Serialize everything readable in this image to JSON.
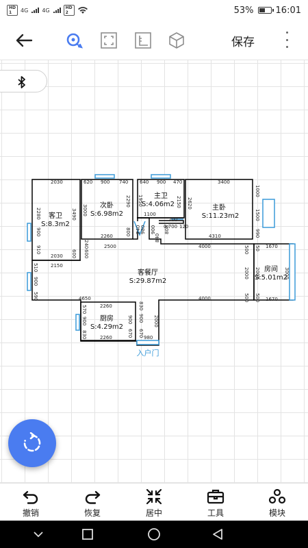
{
  "status": {
    "sim1": {
      "top": "HD",
      "bottom": "1"
    },
    "sim2": {
      "top": "HD",
      "bottom": "2"
    },
    "signal1": "4G",
    "signal2": "4G",
    "battery_percent": "53%",
    "battery_level": 0.53,
    "time": "16:01"
  },
  "toolbar": {
    "save_label": "保存",
    "icons": [
      "arrow-left-icon",
      "pan-move-icon",
      "frame-icon",
      "ruler-icon",
      "3d-box-icon"
    ]
  },
  "bluetooth_icon": "bluetooth-icon",
  "colors": {
    "accent": "#4a7cf0",
    "opening": "#3a9ad9",
    "wall": "#000000",
    "grid": "#e3e3e3"
  },
  "rooms": [
    {
      "name": "客卫",
      "area": "S:8.3m2"
    },
    {
      "name": "次卧",
      "area": "S:6.98m2"
    },
    {
      "name": "主卫",
      "area": "S:4.06m2"
    },
    {
      "name": "主卧",
      "area": "S:11.23m2"
    },
    {
      "name": "客餐厅",
      "area": "S:29.87m2"
    },
    {
      "name": "房间",
      "area": "S:5.01m2"
    },
    {
      "name": "厨房",
      "area": "S:4.29m2"
    }
  ],
  "entrance_label": "入户门",
  "dims": {
    "kewei_top": "2030",
    "kewei_bottom": "2030",
    "kewei_left": "2280",
    "kewei_door": "900",
    "kewei_small": "910",
    "kewei_right": "3490",
    "kewei_rsmall": "600",
    "ciwo_a": "620",
    "ciwo_b": "900",
    "ciwo_c": "740",
    "ciwo_left": "3000",
    "ciwo_right": "2290",
    "ciwo_door": "800",
    "ciwo_bottom": "2260",
    "zhuwei_a": "640",
    "zhuwei_b": "900",
    "zhuwei_c": "470",
    "zhuwei_l1": "1950",
    "zhuwei_r": "2150",
    "zhuwei_1100": "1100",
    "zhuwei_700": "700",
    "zhuwo_top": "3400",
    "zhuwo_l": "2620",
    "zhuwo_r1": "1000",
    "zhuwo_win": "1500",
    "zhuwo_r2": "990",
    "zhuwo_bottom": "4310",
    "c240": "240",
    "c600": "600",
    "c900": "900",
    "c980": "980",
    "c808": "808",
    "c840": "840",
    "c700": "0.700",
    "c120": "120",
    "hall_2150": "2150",
    "hall_2500": "2500",
    "hall_4000a": "4000",
    "hall_4000b": "4000",
    "hall_4650": "4650",
    "hall_510": "510",
    "hall_900": "900",
    "hall_590": "590",
    "hall_2000": "2000",
    "hall_500a": "500",
    "hall_500b": "500",
    "hall_1670a": "1670",
    "hall_1670b": "1670",
    "room_3000": "3000",
    "room_50": "50",
    "room_500": "500",
    "room_2000": "2000",
    "kitchen_top": "2260",
    "kitchen_bottom": "2260",
    "kitchen_570": "570",
    "kitchen_830": "830",
    "kitchen_900": "900",
    "kitchen_670": "670",
    "k_830r": "830",
    "k_900r": "900",
    "k_670r": "670",
    "entry_2000": "2000",
    "entry_980": "980"
  },
  "bottom_tools": [
    {
      "label": "撤销",
      "icon": "undo-icon"
    },
    {
      "label": "恢复",
      "icon": "redo-icon"
    },
    {
      "label": "居中",
      "icon": "center-collapse-icon"
    },
    {
      "label": "工具",
      "icon": "toolbox-icon"
    },
    {
      "label": "模块",
      "icon": "modules-icon"
    }
  ],
  "fab_icon": "rotate-icon"
}
